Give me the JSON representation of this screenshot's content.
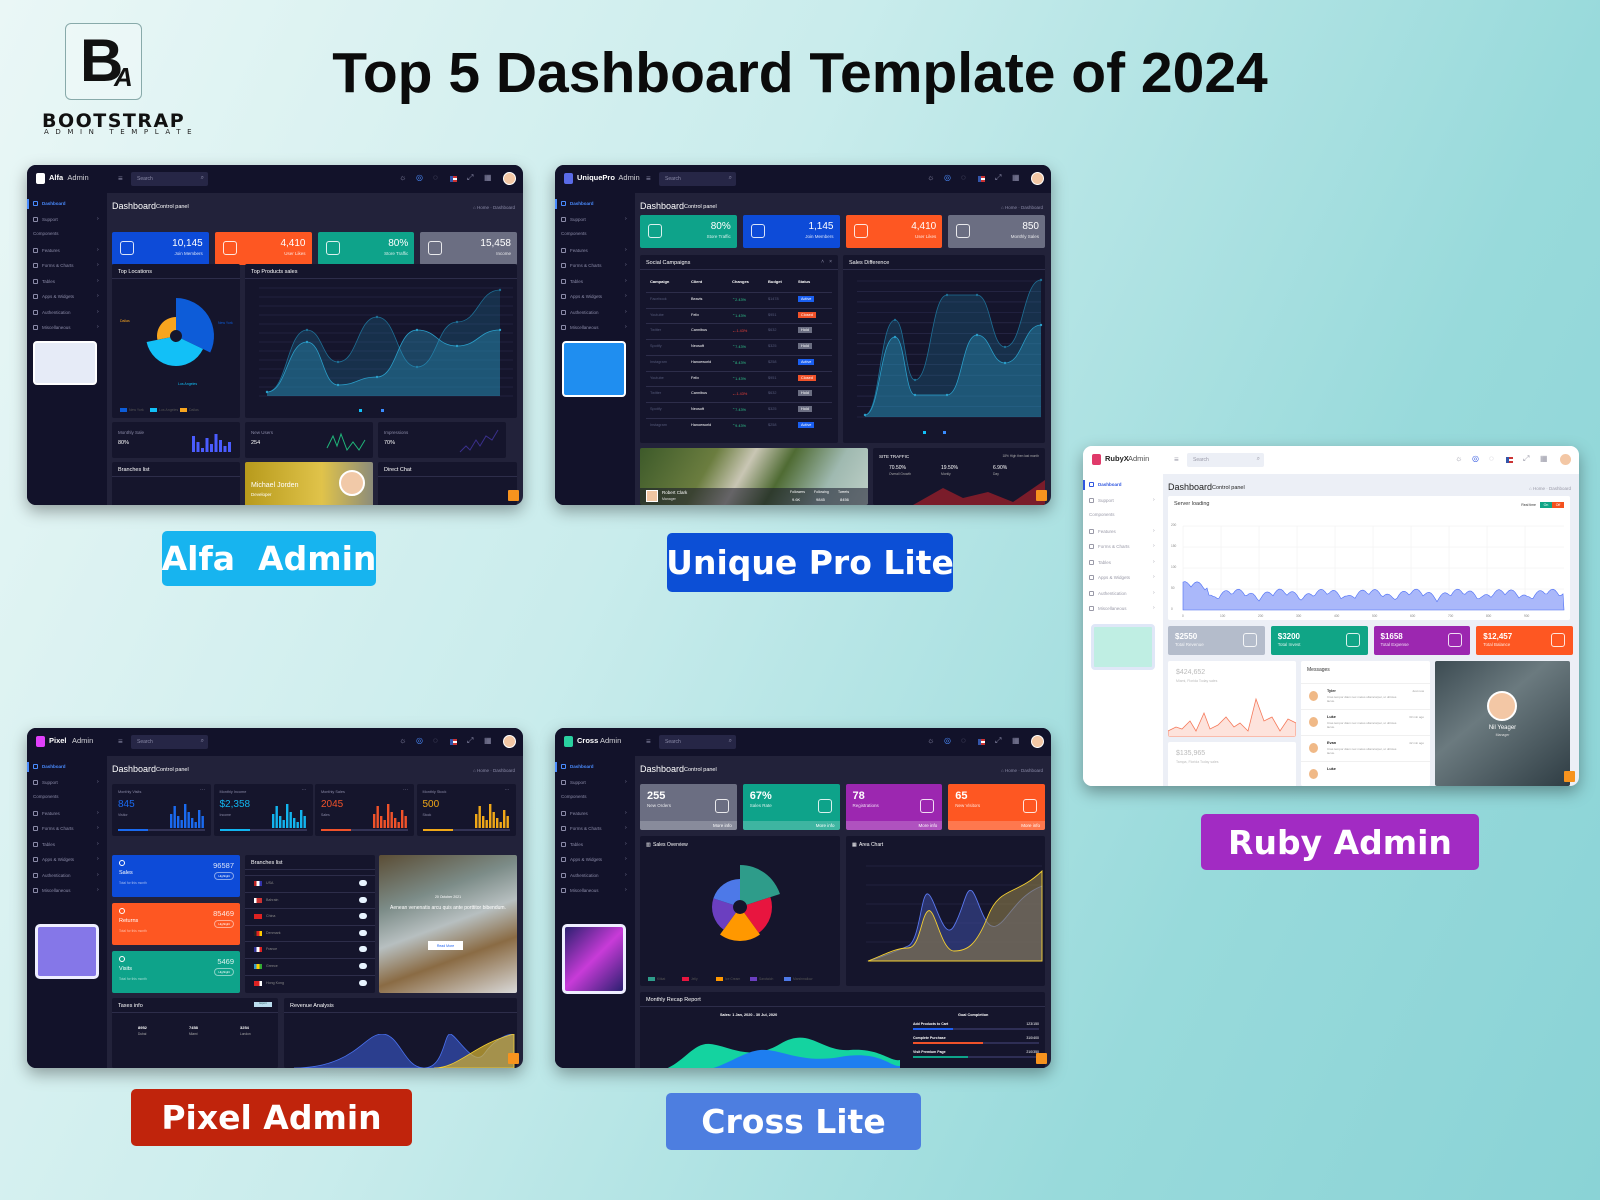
{
  "brand": {
    "logo_letters": "BA",
    "name": "BOOTSTRAP",
    "tagline": "ADMIN TEMPLATE"
  },
  "headline": "Top 5 Dashboard Template of 2024",
  "labels": {
    "alfa": {
      "text": "Alfa  Admin",
      "color": "#17b4ef"
    },
    "unique": {
      "text": "Unique Pro Lite",
      "color": "#0c4fd6"
    },
    "ruby": {
      "text": "Ruby Admin",
      "color": "#a22bc3"
    },
    "pixel": {
      "text": "Pixel Admin",
      "color": "#c0240c"
    },
    "cross": {
      "text": "Cross Lite",
      "color": "#4d7ee0"
    }
  },
  "shared": {
    "search_placeholder": "Search",
    "page_title": "Dashboard",
    "page_subtitle": "Control panel",
    "breadcrumb": [
      "Home",
      "Dashboard"
    ],
    "sidebar": [
      "Dashboard",
      "Support",
      "Components",
      "Features",
      "Forms & Charts",
      "Tables",
      "Apps & Widgets",
      "Authentication",
      "Miscellaneous"
    ]
  },
  "alfa": {
    "logo_bold": "Alfa",
    "logo_light": "Admin",
    "stats": [
      {
        "value": "10,145",
        "label": "Join Members",
        "color": "#0d4bd8",
        "icon": "users-icon"
      },
      {
        "value": "4,410",
        "label": "User Likes",
        "color": "#fe5722",
        "icon": "thumbs-up-icon"
      },
      {
        "value": "80%",
        "label": "Store Traffic",
        "color": "#0ea38a",
        "icon": "bar-chart-icon"
      },
      {
        "value": "15,458",
        "label": "Income",
        "color": "#6b6e82",
        "icon": "briefcase-icon"
      }
    ],
    "top_locations": {
      "title": "Top Locations",
      "labels": [
        "Dallas",
        "New York",
        "Los Angeles"
      ],
      "legend": [
        "New York",
        "Los Angeles",
        "Dallas"
      ]
    },
    "top_products": {
      "title": "Top Products sales"
    },
    "mini": [
      {
        "title": "Monthly Sale",
        "value": "80%"
      },
      {
        "title": "New Users",
        "value": "254"
      },
      {
        "title": "Impressions",
        "value": "70%"
      }
    ],
    "branches": "Branches list",
    "profile": {
      "name": "Michael Jorden",
      "role": "Developer"
    },
    "chat": "Direct Chat"
  },
  "unique": {
    "logo_bold": "UniquePro",
    "logo_light": "Admin",
    "stats": [
      {
        "value": "80%",
        "label": "Store Traffic",
        "color": "#0ea38a",
        "icon": "bar-chart-icon"
      },
      {
        "value": "1,145",
        "label": "Join Members",
        "color": "#0d4bd8",
        "icon": "users-icon"
      },
      {
        "value": "4,410",
        "label": "User Likes",
        "color": "#fe5722",
        "icon": "thumbs-up-icon"
      },
      {
        "value": "850",
        "label": "Monthly Sales",
        "color": "#6b6e82",
        "icon": "briefcase-icon"
      }
    ],
    "campaigns": {
      "title": "Social Campaigns",
      "columns": [
        "Campaign",
        "Client",
        "Changes",
        "Budget",
        "Status"
      ],
      "rows": [
        [
          "Facebook",
          "Beavis",
          "2.43%",
          "$1478",
          "Active"
        ],
        [
          "Youtube",
          "Felix",
          "1.43%",
          "$951",
          "Closed"
        ],
        [
          "Twitter",
          "Cannibus",
          "-1.43%",
          "$632",
          "Hold"
        ],
        [
          "Spotify",
          "Neosoft",
          "7.43%",
          "$325",
          "Hold"
        ],
        [
          "Instagram",
          "Hanoeworld",
          "8.43%",
          "$258",
          "Active"
        ],
        [
          "Youtube",
          "Felix",
          "1.43%",
          "$951",
          "Closed"
        ],
        [
          "Twitter",
          "Cannibus",
          "-1.43%",
          "$632",
          "Hold"
        ],
        [
          "Spotify",
          "Neosoft",
          "7.43%",
          "$325",
          "Hold"
        ],
        [
          "Instagram",
          "Hanoeworld",
          "9.43%",
          "$258",
          "Active"
        ]
      ]
    },
    "sales_difference": "Sales Difference",
    "profile": {
      "name": "Robert Clark",
      "role": "Manager",
      "stats": [
        {
          "label": "Followers",
          "value": "9.6K"
        },
        {
          "label": "Following",
          "value": "9845"
        },
        {
          "label": "Tweets",
          "value": "8456"
        }
      ]
    },
    "site_traffic": {
      "title": "SITE TRAFFIC",
      "note": "18% High then last month",
      "items": [
        {
          "value": "70.50%",
          "label": "Overall Growth"
        },
        {
          "value": "19.50%",
          "label": "Montly"
        },
        {
          "value": "6.90%",
          "label": "Day"
        }
      ]
    }
  },
  "ruby": {
    "logo_bold": "RubyX",
    "logo_light": "Admin",
    "server": {
      "title": "Server loading",
      "realtime_label": "Real time",
      "on": "On",
      "off": "Off",
      "yticks": [
        "200",
        "150",
        "100",
        "50",
        "0"
      ],
      "xticks": [
        "0",
        "100",
        "200",
        "300",
        "400",
        "500",
        "600",
        "700",
        "800",
        "900"
      ]
    },
    "stats": [
      {
        "value": "$2550",
        "label": "Total Revenue",
        "color": "#b4bccb",
        "icon": "document-icon"
      },
      {
        "value": "$3200",
        "label": "Total Invest",
        "color": "#10a586",
        "icon": "list-icon"
      },
      {
        "value": "$1658",
        "label": "Total Expense",
        "color": "#9c27b0",
        "icon": "user-icon"
      },
      {
        "value": "$12,457",
        "label": "Total Balance",
        "color": "#fe5722",
        "icon": "briefcase-icon"
      }
    ],
    "sales1": {
      "value": "$424,652",
      "label": "Miami, Florida Today sales"
    },
    "sales2": {
      "value": "$135,965",
      "label": "Tampa, Florida Today sales"
    },
    "messages": {
      "title": "Messages",
      "items": [
        {
          "name": "Tyler",
          "time": "Just now",
          "text": "Cras tempor diam nec metus ullamcorper, ut ultrices lacus."
        },
        {
          "name": "Luke",
          "time": "33 min ago",
          "text": "Cras tempor diam nec metus ullamcorper, ut ultrices lacus."
        },
        {
          "name": "Evan",
          "time": "42 min ago",
          "text": "Cras tempor diam nec metus ullamcorper, ut ultrices lacus."
        },
        {
          "name": "Luke",
          "time": "",
          "text": ""
        }
      ]
    },
    "profile": {
      "name": "Nil Yeager",
      "role": "Manager"
    }
  },
  "pixel": {
    "logo_bold": "Pixel",
    "logo_light": "Admin",
    "stats": [
      {
        "title": "Monthly Visits",
        "value": "845",
        "label": "Visitor",
        "color": "#1a6af0"
      },
      {
        "title": "Monthly Income",
        "value": "$2,358",
        "label": "Income",
        "color": "#12b5f0"
      },
      {
        "title": "Monthly Sales",
        "value": "2045",
        "label": "Sales",
        "color": "#f0522a"
      },
      {
        "title": "Monthly Stock",
        "value": "500",
        "label": "Stock",
        "color": "#f0a818"
      }
    ],
    "cards": [
      {
        "title": "Sales",
        "value": "96587",
        "sub": "Total for this month",
        "badge": "Highlight",
        "color": "#0d4bd8",
        "icon": "circle-icon"
      },
      {
        "title": "Returns",
        "value": "85469",
        "sub": "Total for this month",
        "badge": "Highlight",
        "color": "#fe5722",
        "icon": "truck-icon"
      },
      {
        "title": "Visits",
        "value": "5469",
        "sub": "Total for this month",
        "badge": "Highlight",
        "color": "#0ea38a",
        "icon": "users-icon"
      }
    ],
    "branches": {
      "title": "Branches list",
      "items": [
        "USA",
        "Bahrain",
        "China",
        "Denmark",
        "France",
        "Greece",
        "Hong Kong"
      ]
    },
    "feature": {
      "date": "20 October 2021",
      "text": "Aenean venenatis arcu quis ante porttitor bibendum.",
      "button": "Read More"
    },
    "taxes": {
      "title": "Taxes info",
      "button": "Export",
      "items": [
        {
          "value": "8952",
          "label": "Dubai"
        },
        {
          "value": "7458",
          "label": "Miami"
        },
        {
          "value": "3254",
          "label": "London"
        }
      ]
    },
    "revenue": "Revenue Analysis"
  },
  "cross": {
    "logo_bold": "Cross",
    "logo_light": "Admin",
    "stats": [
      {
        "value": "255",
        "label": "New Orders",
        "color": "#6b6e82",
        "icon": "shopping-bag-icon"
      },
      {
        "value": "67%",
        "label": "Sales Rate",
        "color": "#0ea38a",
        "icon": "bar-chart-icon"
      },
      {
        "value": "78",
        "label": "Registrations",
        "color": "#9c27b0",
        "icon": "user-plus-icon"
      },
      {
        "value": "65",
        "label": "New Visitors",
        "color": "#fe5722",
        "icon": "pie-chart-icon"
      }
    ],
    "more_info": "More info",
    "sales_overview": {
      "title": "Sales Overview",
      "legend": [
        "Kitkat",
        "Jelly",
        "Ice Cream",
        "Sandwich",
        "Marshmallow"
      ]
    },
    "area_chart": "Area Chart",
    "recap": {
      "title": "Monthly Recap Report",
      "range": "Sales: 1 Jan, 2020 - 30 Jul, 2020",
      "goal_title": "Goal Completion",
      "goals": [
        {
          "label": "Add Products to Cart",
          "value": "123/150"
        },
        {
          "label": "Complete Purchase",
          "value": "310/400"
        },
        {
          "label": "Visit Premium Page",
          "value": "210/350"
        }
      ]
    }
  }
}
